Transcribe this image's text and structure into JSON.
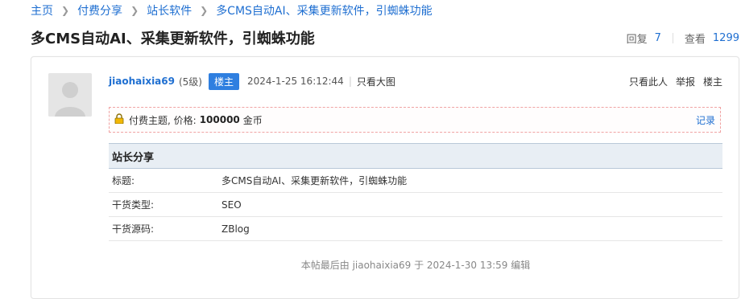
{
  "breadcrumb": {
    "items": [
      "主页",
      "付费分享",
      "站长软件",
      "多CMS自动AI、采集更新软件，引蜘蛛功能"
    ],
    "separator": ">"
  },
  "thread": {
    "title": "多CMS自动AI、采集更新软件，引蜘蛛功能",
    "replies_label": "回复",
    "replies": "7",
    "views_label": "查看",
    "views": "1299"
  },
  "post": {
    "author": "jiaohaixia69",
    "level": "(5级)",
    "owner_badge": "楼主",
    "time": "2024-1-25 16:12:44",
    "sep": "|",
    "view_big": "只看大图",
    "actions": [
      "只看此人",
      "举报",
      "楼主"
    ],
    "pay": {
      "label": "付费主题, 价格:",
      "price": "100000",
      "unit": "金币",
      "record": "记录"
    },
    "table": {
      "header": "站长分享",
      "rows": [
        {
          "key": "标题:",
          "value": "多CMS自动AI、采集更新软件，引蜘蛛功能"
        },
        {
          "key": "干货类型:",
          "value": "SEO"
        },
        {
          "key": "干货源码:",
          "value": "ZBlog"
        }
      ]
    },
    "edit_note": "本帖最后由 jiaohaixia69 于 2024-1-30 13:59 编辑"
  },
  "colors": {
    "link": "#1f6fd1",
    "badge": "#2f7fe0",
    "pay_border": "#f0a3a3",
    "table_header_bg": "#e8eef4"
  },
  "icons": {
    "lock": "lock-icon",
    "avatar": "default-avatar-icon",
    "chevron": "chevron-right-icon"
  }
}
